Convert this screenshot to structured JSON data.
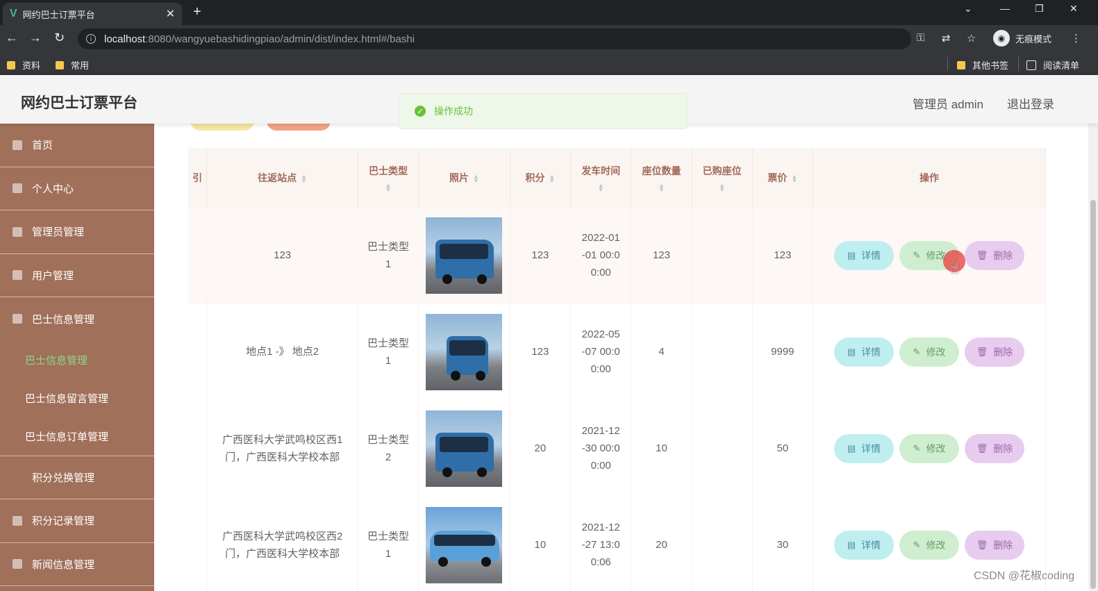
{
  "browser": {
    "tab_title": "网约巴士订票平台",
    "tab_favicon": "V",
    "url_host": "localhost",
    "url_path": ":8080/wangyuebashidingpiao/admin/dist/index.html#/bashi",
    "incognito_label": "无痕模式",
    "bookmarks": [
      "资料",
      "常用"
    ],
    "other_bookmarks": "其他书签",
    "reading_list": "阅读清单"
  },
  "header": {
    "title": "网约巴士订票平台",
    "user_label": "管理员 admin",
    "logout_label": "退出登录"
  },
  "toast": {
    "message": "操作成功"
  },
  "sidebar": {
    "items": [
      {
        "label": "首页"
      },
      {
        "label": "个人中心"
      },
      {
        "label": "管理员管理"
      },
      {
        "label": "用户管理"
      },
      {
        "label": "巴士信息管理"
      }
    ],
    "submenu": [
      {
        "label": "巴士信息管理",
        "active": true
      },
      {
        "label": "巴士信息留言管理"
      },
      {
        "label": "巴士信息订单管理"
      }
    ],
    "items_after": [
      {
        "label": "积分兑换管理"
      },
      {
        "label": "积分记录管理"
      },
      {
        "label": "新闻信息管理"
      }
    ]
  },
  "table": {
    "headers": {
      "index_partial": "引",
      "route": "往返站点",
      "bus_type": "巴士类型",
      "photo": "照片",
      "points": "积分",
      "departure": "发车时间",
      "seats": "座位数量",
      "booked": "已购座位",
      "price": "票价",
      "actions": "操作"
    },
    "rows": [
      {
        "route": "123",
        "bus_type_a": "巴士类型",
        "bus_type_b": "1",
        "points": "123",
        "dep_a": "2022-01",
        "dep_b": "-01 00:0",
        "dep_c": "0:00",
        "seats": "123",
        "price": "123"
      },
      {
        "route": "地点1 -》 地点2",
        "bus_type_a": "巴士类型",
        "bus_type_b": "1",
        "points": "123",
        "dep_a": "2022-05",
        "dep_b": "-07 00:0",
        "dep_c": "0:00",
        "seats": "4",
        "price": "9999"
      },
      {
        "route_a": "广西医科大学武鸣校区西1",
        "route_b": "门，广西医科大学校本部",
        "bus_type_a": "巴士类型",
        "bus_type_b": "2",
        "points": "20",
        "dep_a": "2021-12",
        "dep_b": "-30 00:0",
        "dep_c": "0:00",
        "seats": "10",
        "price": "50"
      },
      {
        "route_a": "广西医科大学武鸣校区西2",
        "route_b": "门，广西医科大学校本部",
        "bus_type_a": "巴士类型",
        "bus_type_b": "1",
        "points": "10",
        "dep_a": "2021-12",
        "dep_b": "-27 13:0",
        "dep_c": "0:06",
        "seats": "20",
        "price": "30"
      }
    ],
    "buttons": {
      "detail": "详情",
      "edit": "修改",
      "delete": "删除"
    }
  },
  "watermark": "CSDN @花椒coding",
  "colors": {
    "sidebar": "#a0705a",
    "active_submenu": "#8bd68a",
    "toast_green": "#67c23a"
  }
}
